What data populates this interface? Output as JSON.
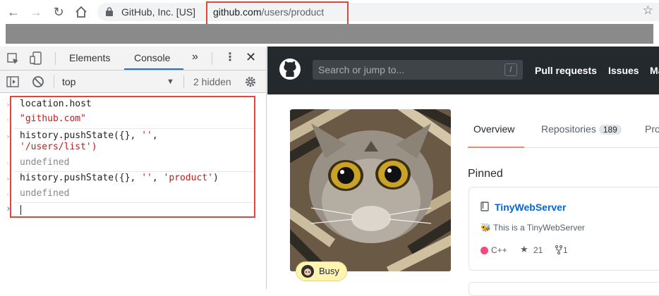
{
  "browser": {
    "site_identity": "GitHub, Inc. [US]",
    "url_host": "github.com",
    "url_path": "/users/product"
  },
  "devtools": {
    "tabs": [
      "Elements",
      "Console"
    ],
    "more_tabs": "»",
    "context": "top",
    "hidden": "2 hidden",
    "console_lines": [
      {
        "kind": "input",
        "text": "location.host"
      },
      {
        "kind": "result-string",
        "text": "\"github.com\""
      },
      {
        "kind": "input",
        "text": "history.pushState({}, '',"
      },
      {
        "kind": "input-cont",
        "text": "'/users/list')"
      },
      {
        "kind": "result",
        "text": "undefined"
      },
      {
        "kind": "input",
        "text": "history.pushState({}, '', 'product')"
      },
      {
        "kind": "result",
        "text": "undefined"
      }
    ]
  },
  "github": {
    "search_placeholder": "Search or jump to...",
    "search_shortcut": "/",
    "nav": [
      "Pull requests",
      "Issues",
      "Ma"
    ],
    "status_badge": "Busy",
    "tabs": {
      "overview": "Overview",
      "repositories": "Repositories",
      "repositories_count": "189",
      "projects": "Pro"
    },
    "pinned_label": "Pinned",
    "pinned_repo": {
      "name": "TinyWebServer",
      "description": "This is a TinyWebServer",
      "language": "C++",
      "language_color": "#f34b7d",
      "stars": "21",
      "forks": "1"
    }
  }
}
